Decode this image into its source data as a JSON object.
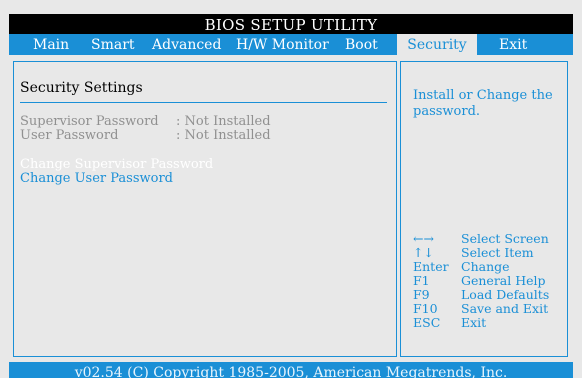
{
  "title": "BIOS SETUP UTILITY",
  "menu": [
    {
      "label": "Main"
    },
    {
      "label": "Smart"
    },
    {
      "label": "Advanced"
    },
    {
      "label": "H/W Monitor"
    },
    {
      "label": "Boot"
    },
    {
      "label": "Security",
      "selected": true
    },
    {
      "label": "Exit"
    }
  ],
  "main": {
    "section_title": "Security Settings",
    "fields": [
      {
        "label": "Supervisor Password",
        "value": ": Not Installed"
      },
      {
        "label": "User Password",
        "value": ": Not Installed"
      }
    ],
    "actions": [
      {
        "label": "Change Supervisor Password",
        "highlighted": true
      },
      {
        "label": "Change User Password",
        "highlighted": false
      }
    ]
  },
  "help": {
    "text": "Install or Change the password.",
    "keys": [
      {
        "key": "←→",
        "desc": "Select Screen"
      },
      {
        "key": "↑↓",
        "desc": "Select Item"
      },
      {
        "key": "Enter",
        "desc": "Change"
      },
      {
        "key": "F1",
        "desc": "General Help"
      },
      {
        "key": "F9",
        "desc": "Load Defaults"
      },
      {
        "key": "F10",
        "desc": "Save and Exit"
      },
      {
        "key": "ESC",
        "desc": "Exit"
      }
    ]
  },
  "footer": "v02.54 (C) Copyright 1985-2005, American Megatrends, Inc.",
  "colors": {
    "accent": "#1a8fd6",
    "background": "#e8e8e8",
    "title_bar": "#000000",
    "highlight_text": "#ffffff",
    "disabled_text": "#909090"
  }
}
